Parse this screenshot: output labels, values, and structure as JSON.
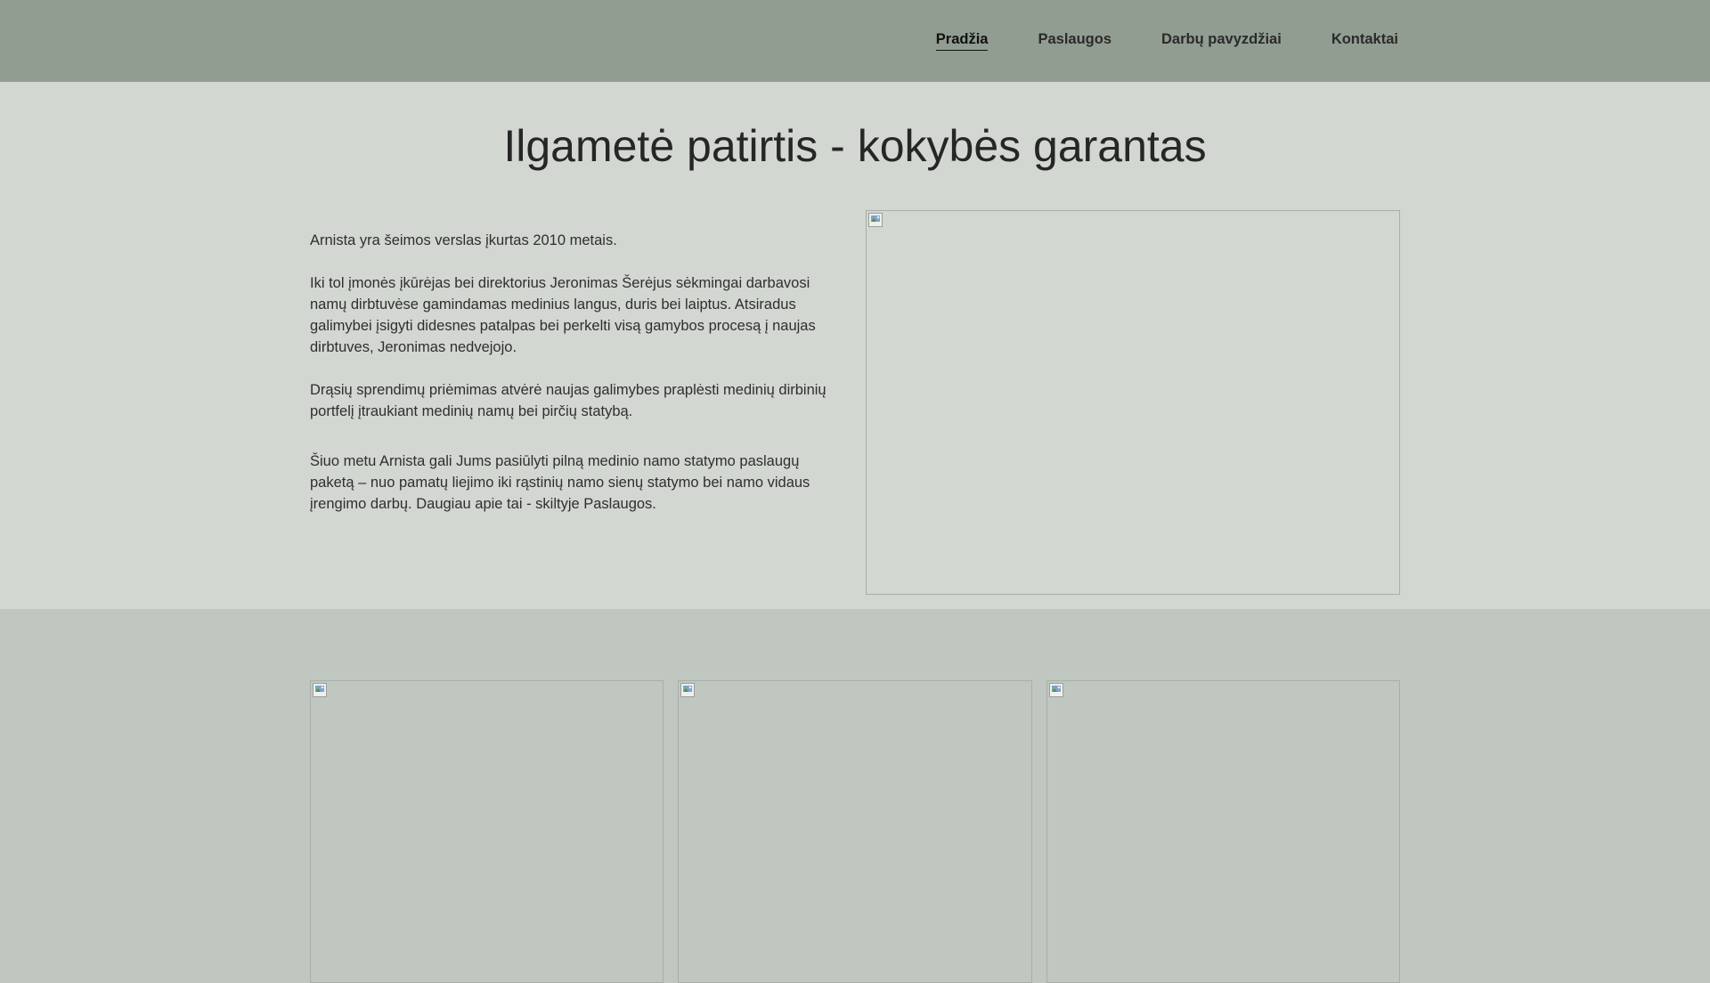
{
  "nav": {
    "items": [
      {
        "label": "Pradžia",
        "active": true
      },
      {
        "label": "Paslaugos",
        "active": false
      },
      {
        "label": "Darbų pavyzdžiai",
        "active": false
      },
      {
        "label": "Kontaktai",
        "active": false
      }
    ]
  },
  "about": {
    "title": "Ilgametė patirtis - kokybės garantas",
    "paragraphs": [
      "Arnista yra šeimos verslas įkurtas 2010 metais.",
      "Iki tol įmonės įkūrėjas bei direktorius Jeronimas Šerėjus sėkmingai darbavosi namų dirbtuvėse gamindamas medinius langus, duris bei laiptus. Atsiradus galimybei įsigyti didesnes patalpas bei perkelti visą gamybos procesą į naujas dirbtuves, Jeronimas nedvejojo.",
      "Drąsių sprendimų priėmimas atvėrė naujas galimybes praplėsti medinių dirbinių portfelį įtraukiant medinių namų bei pirčių statybą.",
      "Šiuo metu Arnista gali Jums pasiūlyti pilną medinio namo statymo paslaugų paketą – nuo pamatų liejimo iki rąstinių namo sienų statymo bei namo vidaus įrengimo darbų. Daugiau apie tai - skiltyje Paslaugos."
    ]
  },
  "colors": {
    "header_bg": "#929d92",
    "about_bg": "#d2d7d1",
    "gallery_bg": "#c0c7c0"
  },
  "icons": {
    "image_placeholder": "broken-image-icon"
  }
}
